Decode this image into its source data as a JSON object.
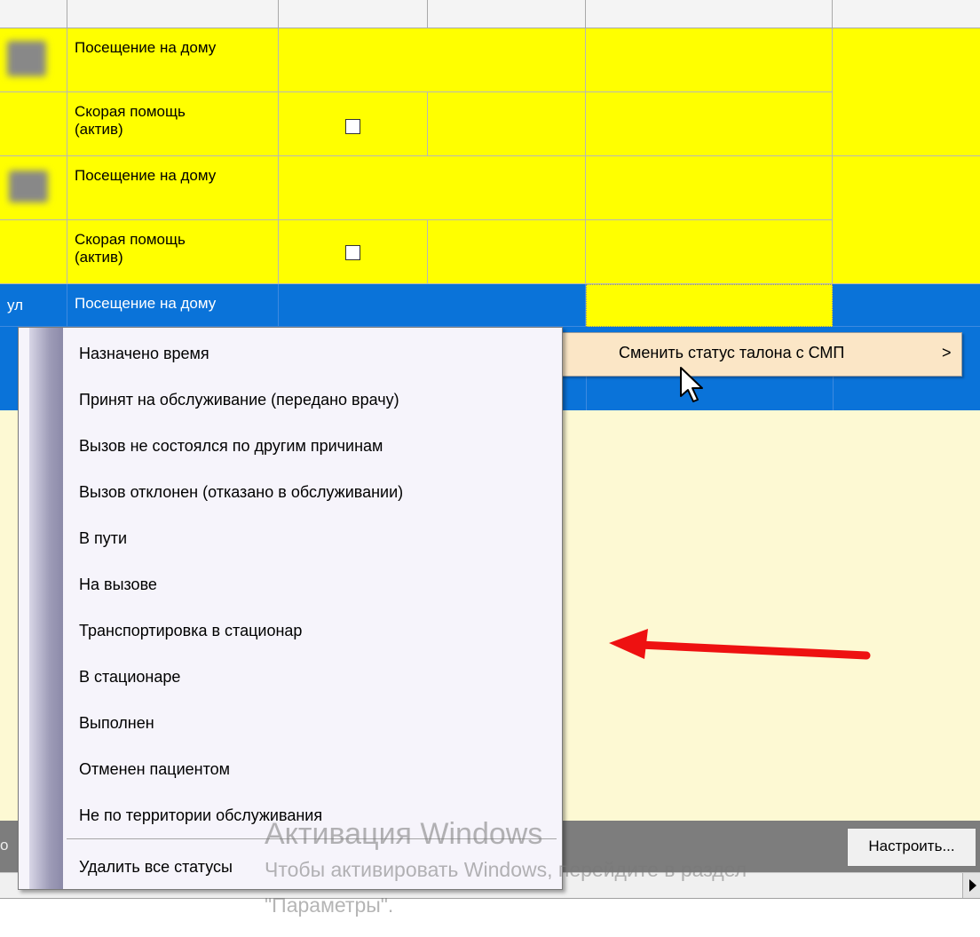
{
  "grid": {
    "rows": [
      {
        "left_text": "",
        "type_text": "Посещение на дому"
      },
      {
        "left_text": "",
        "type_text": "Скорая помощь (актив)"
      },
      {
        "left_text": "",
        "type_text": "Посещение на дому"
      },
      {
        "left_text": "",
        "type_text": "Скорая помощь (актив)"
      },
      {
        "left_text": "ул",
        "type_text": "Посещение на дому"
      }
    ],
    "checkbox_rows": [
      "row-2",
      "row-4"
    ]
  },
  "submenu_parent": {
    "label": "Сменить статус талона с СМП",
    "arrow": ">"
  },
  "context_menu": {
    "items": [
      "Назначено время",
      "Принят на обслуживание (передано врачу)",
      "Вызов не состоялся по другим причинам",
      "Вызов отклонен (отказано в обслуживании)",
      "В пути",
      "На вызове",
      "Транспортировка в стационар",
      "В стационаре",
      "Выполнен",
      "Отменен пациентом",
      "Не по территории обслуживания"
    ],
    "delete_all": "Удалить все статусы"
  },
  "bottom": {
    "configure_button": "Настроить...",
    "left_cut_text": "о"
  },
  "watermark": {
    "title": "Активация Windows",
    "line1": "Чтобы активировать Windows, перейдите в раздел",
    "line2": "\"Параметры\"."
  },
  "colors": {
    "row_yellow": "#ffff00",
    "selected_blue": "#0a73d9",
    "panel_cream": "#fdf9d3",
    "arrow_red": "#ee1111"
  }
}
